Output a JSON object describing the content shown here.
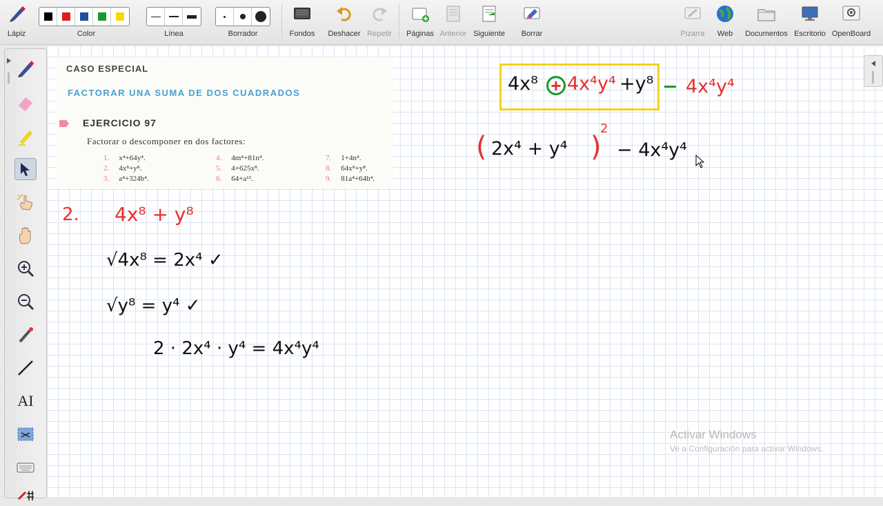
{
  "toolbar": {
    "pen_label": "Lápiz",
    "color_label": "Color",
    "colors": [
      "#000000",
      "#e21b1b",
      "#1e4fa0",
      "#1a9a2a",
      "#f5d90a"
    ],
    "line_label": "Línea",
    "eraser_label": "Borrador",
    "backgrounds_label": "Fondos",
    "undo_label": "Deshacer",
    "redo_label": "Repetir",
    "pages_label": "Páginas",
    "previous_label": "Anterior",
    "next_label": "Siguiente",
    "clear_label": "Borrar",
    "board_label": "Pizarra",
    "web_label": "Web",
    "documents_label": "Documentos",
    "desktop_label": "Escritorio",
    "openboard_label": "OpenBoard"
  },
  "palette": {
    "items": [
      "pen-tool",
      "eraser-tool",
      "marker-tool",
      "selector-tool",
      "interact-tool",
      "hand-tool",
      "zoom-in-tool",
      "zoom-out-tool",
      "laser-pointer-tool",
      "line-tool",
      "text-tool",
      "capture-tool",
      "keyboard-tool"
    ],
    "text_tool_label": "AI",
    "selected": "selector-tool"
  },
  "excerpt": {
    "special_case": "CASO ESPECIAL",
    "title": "FACTORAR UNA SUMA DE DOS CUADRADOS",
    "exercise": "EJERCICIO 97",
    "instruction": "Factorar o descomponer en dos factores:",
    "items": [
      {
        "num": "1.",
        "expr": "x⁴+64y⁴."
      },
      {
        "num": "2.",
        "expr": "4x⁸+y⁸."
      },
      {
        "num": "3.",
        "expr": "a⁴+324b⁴."
      },
      {
        "num": "4.",
        "expr": "4m⁴+81n⁴."
      },
      {
        "num": "5.",
        "expr": "4+625x⁸."
      },
      {
        "num": "6.",
        "expr": "64+a¹²."
      },
      {
        "num": "7.",
        "expr": "1+4n⁴."
      },
      {
        "num": "8.",
        "expr": "64x⁸+y⁸."
      },
      {
        "num": "9.",
        "expr": "81a⁴+64b⁴."
      }
    ]
  },
  "handwriting": {
    "problem_number": "2.",
    "problem_expr": "4x⁸ + y⁸",
    "root1": "√4x⁸ = 2x⁴ ✓",
    "root2": "√y⁸ = y⁴ ✓",
    "double_product": "2 · 2x⁴ · y⁴ = 4x⁴y⁴",
    "boxed_expr": {
      "left": "4x⁸",
      "plus_circled": "+",
      "middle": "4x⁴y⁴",
      "right": "+y⁸"
    },
    "minus_term": "4x⁴y⁴",
    "minus_sign": "−",
    "square_line": {
      "paren_open": "(",
      "inner": "2x⁴ + y⁴",
      "paren_close": ")",
      "exp": "2",
      "rest": "− 4x⁴y⁴"
    }
  },
  "watermark": {
    "title": "Activar Windows",
    "subtitle": "Ve a Configuración para activar Windows."
  }
}
